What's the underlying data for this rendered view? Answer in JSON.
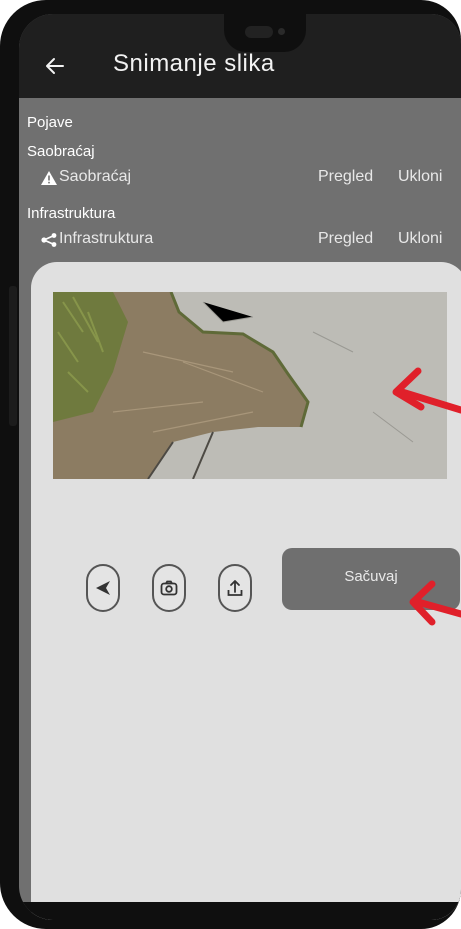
{
  "appbar": {
    "title": "Snimanje slika",
    "back_icon": "arrow-left-icon"
  },
  "list": {
    "header": "Pojave",
    "groups": [
      {
        "title": "Saobraćaj",
        "item": {
          "label": "Saobraćaj",
          "icon": "warning-icon",
          "view": "Pregled",
          "remove": "Ukloni"
        }
      },
      {
        "title": "Infrastruktura",
        "item": {
          "label": "Infrastruktura",
          "icon": "share-nodes-icon",
          "view": "Pregled",
          "remove": "Ukloni"
        }
      }
    ]
  },
  "sheet": {
    "photo_subject": "damaged asphalt road with pothole",
    "buttons": [
      {
        "icon": "send-icon"
      },
      {
        "icon": "camera-icon"
      },
      {
        "icon": "upload-icon"
      }
    ],
    "save_label": "Sačuvaj"
  },
  "colors": {
    "annotation_arrow": "#e0202a",
    "appbar": "#1f1f1f",
    "sheet": "#e0e0e0",
    "save_button": "#6f6f6f"
  }
}
